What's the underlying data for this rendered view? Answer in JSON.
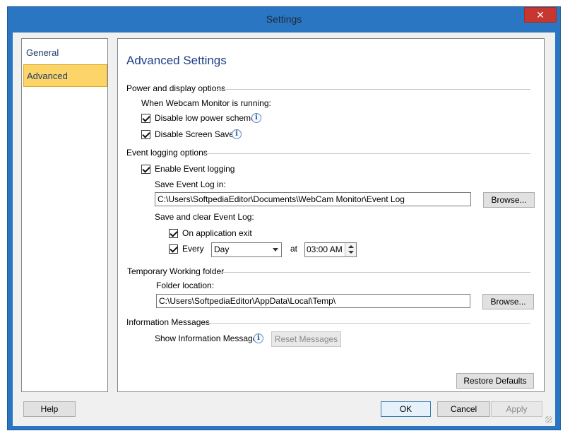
{
  "window": {
    "title": "Settings",
    "close_glyph": "✕",
    "close_icon": "close-icon"
  },
  "nav": {
    "items": [
      {
        "label": "General"
      },
      {
        "label": "Advanced"
      }
    ]
  },
  "panel": {
    "heading": "Advanced Settings",
    "power": {
      "label": "Power and display options",
      "subtitle": "When Webcam Monitor is running:",
      "low_power": "Disable low power schemes",
      "screen_saver": "Disable Screen Saver"
    },
    "logging": {
      "label": "Event logging options",
      "enable": "Enable Event logging",
      "save_in_label": "Save Event Log in:",
      "path": "C:\\Users\\SoftpediaEditor\\Documents\\WebCam Monitor\\Event Log",
      "browse": "Browse...",
      "clear_label": "Save and clear Event Log:",
      "on_exit": "On application exit",
      "every": "Every",
      "period": "Day",
      "at": "at",
      "time": "03:00 AM"
    },
    "temp": {
      "label": "Temporary Working folder",
      "location_label": "Folder location:",
      "path": "C:\\Users\\SoftpediaEditor\\AppData\\Local\\Temp\\",
      "browse": "Browse..."
    },
    "info": {
      "label": "Information Messages",
      "show": "Show Information Messages",
      "reset": "Reset Messages"
    },
    "restore": "Restore Defaults",
    "info_glyph": "i"
  },
  "footer": {
    "help": "Help",
    "ok": "OK",
    "cancel": "Cancel",
    "apply": "Apply"
  }
}
